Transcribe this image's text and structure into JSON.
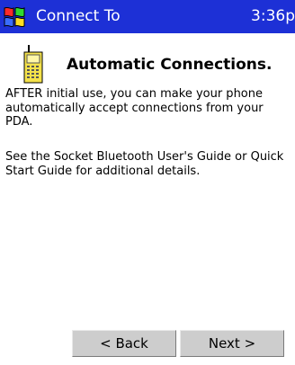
{
  "title_bar": {
    "start_icon": "windows-flag-icon",
    "title": "Connect To",
    "clock": "3:36p"
  },
  "content": {
    "icon": "mobile-phone-icon",
    "heading": "Automatic Connections.",
    "paragraph1": "AFTER initial use, you can make your phone automatically accept connections from your PDA.",
    "paragraph2": "See the Socket Bluetooth User's Guide or Quick Start Guide for additional details."
  },
  "buttons": {
    "back": "< Back",
    "next": "Next >"
  }
}
